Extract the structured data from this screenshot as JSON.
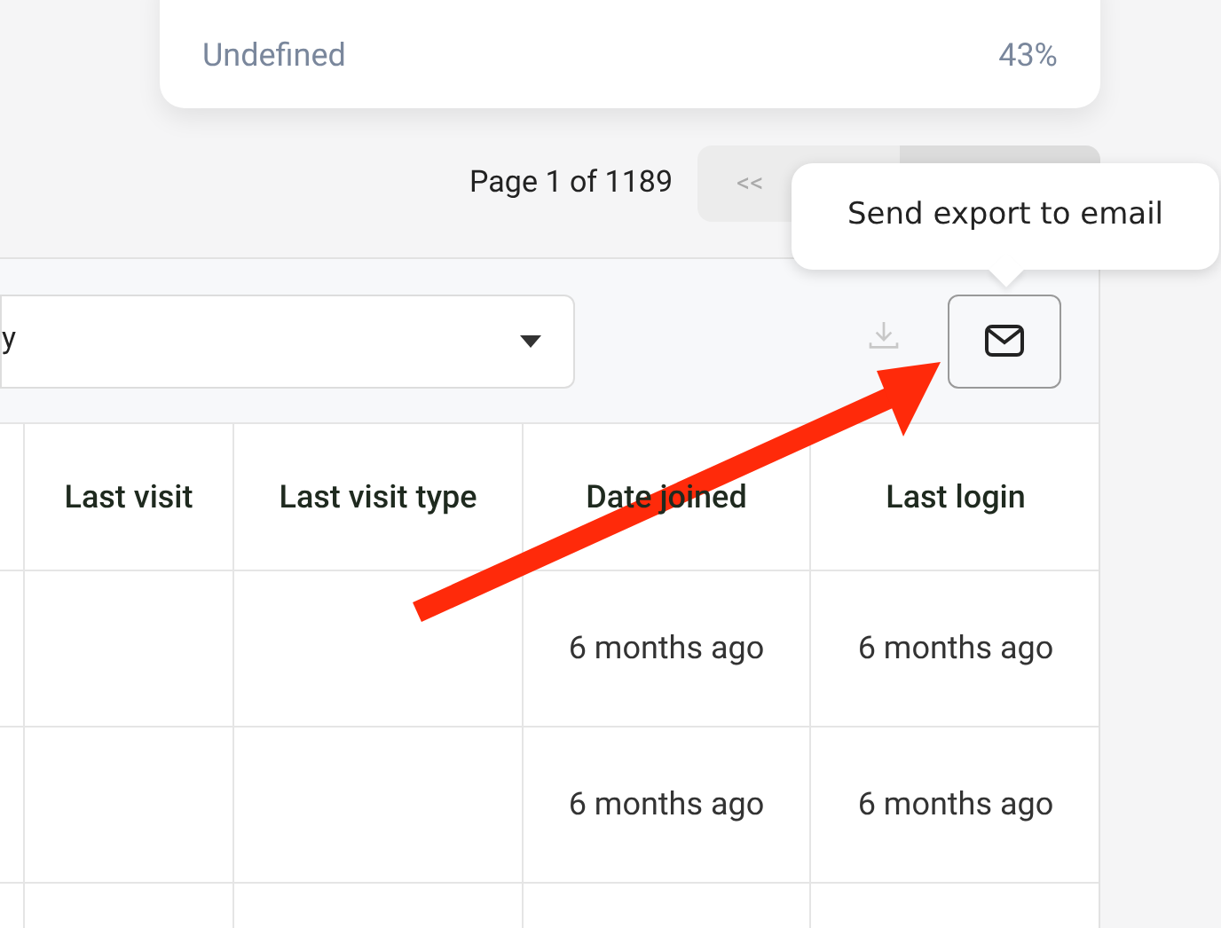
{
  "stats_card": {
    "rows": [
      {
        "label": "Undefined",
        "value": "43%"
      }
    ]
  },
  "pagination": {
    "page_text": "Page 1 of 1189",
    "first_button": "<<"
  },
  "tooltip": {
    "text": "Send export to email"
  },
  "filter": {
    "value": "y"
  },
  "export": {
    "download_disabled": true
  },
  "table": {
    "columns": [
      "Last visit",
      "Last visit type",
      "Date joined",
      "Last login"
    ],
    "rows": [
      {
        "last_visit": "",
        "last_visit_type": "",
        "date_joined": "6 months ago",
        "last_login": "6 months ago"
      },
      {
        "last_visit": "",
        "last_visit_type": "",
        "date_joined": "6 months ago",
        "last_login": "6 months ago"
      }
    ]
  }
}
